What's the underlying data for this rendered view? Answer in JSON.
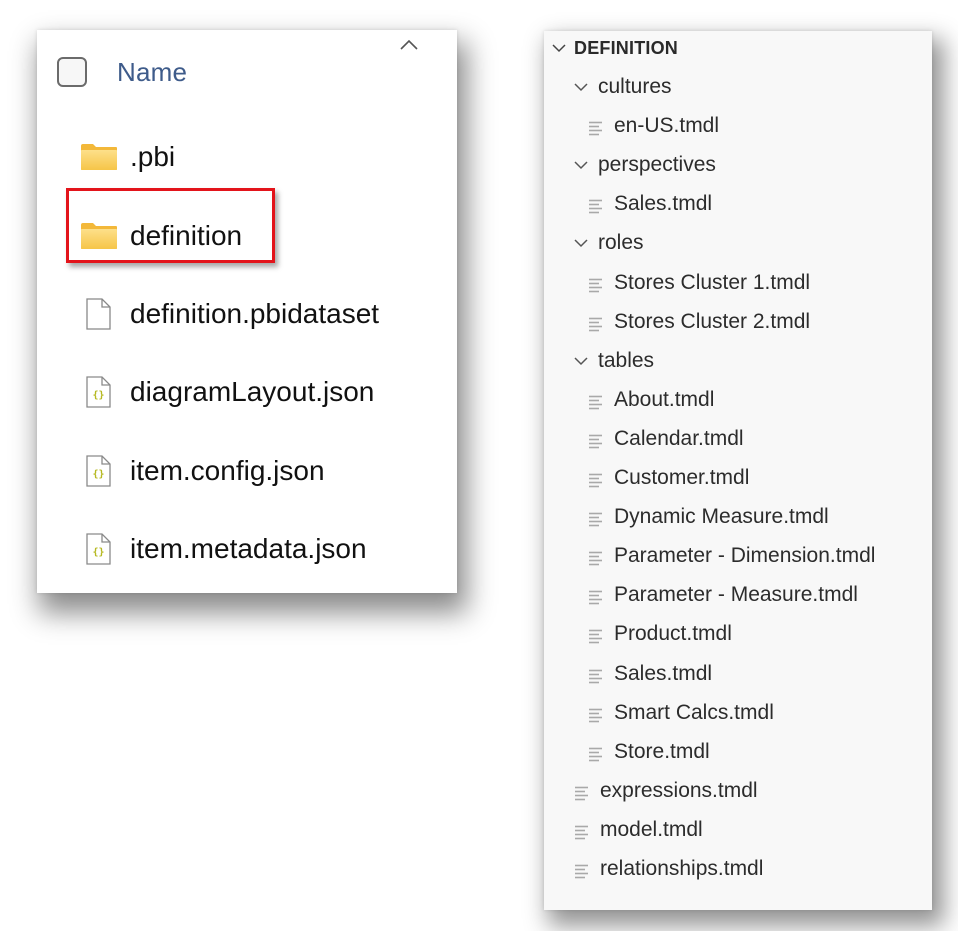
{
  "file_explorer": {
    "header": {
      "sort_indicator_icon": "chevron-up-icon",
      "select_all_checked": false,
      "name_column_label": "Name"
    },
    "items": [
      {
        "name": ".pbi",
        "type": "folder",
        "icon": "folder-icon",
        "highlighted": false
      },
      {
        "name": "definition",
        "type": "folder",
        "icon": "folder-icon",
        "highlighted": true
      },
      {
        "name": "definition.pbidataset",
        "type": "file",
        "icon": "file-icon",
        "highlighted": false
      },
      {
        "name": "diagramLayout.json",
        "type": "json",
        "icon": "json-file-icon",
        "highlighted": false
      },
      {
        "name": "item.config.json",
        "type": "json",
        "icon": "json-file-icon",
        "highlighted": false
      },
      {
        "name": "item.metadata.json",
        "type": "json",
        "icon": "json-file-icon",
        "highlighted": false
      }
    ],
    "highlight_color": "#e3141b",
    "folder_color": "#f5c94a",
    "json_brace_color": "#b5b81f"
  },
  "tree": {
    "root": {
      "label": "DEFINITION",
      "expanded": true
    },
    "nodes": [
      {
        "label": "cultures",
        "kind": "folder",
        "level": 1,
        "expanded": true
      },
      {
        "label": "en-US.tmdl",
        "kind": "file",
        "level": 2
      },
      {
        "label": "perspectives",
        "kind": "folder",
        "level": 1,
        "expanded": true
      },
      {
        "label": "Sales.tmdl",
        "kind": "file",
        "level": 2
      },
      {
        "label": "roles",
        "kind": "folder",
        "level": 1,
        "expanded": true
      },
      {
        "label": "Stores Cluster 1.tmdl",
        "kind": "file",
        "level": 2
      },
      {
        "label": "Stores Cluster 2.tmdl",
        "kind": "file",
        "level": 2
      },
      {
        "label": "tables",
        "kind": "folder",
        "level": 1,
        "expanded": true
      },
      {
        "label": "About.tmdl",
        "kind": "file",
        "level": 2
      },
      {
        "label": "Calendar.tmdl",
        "kind": "file",
        "level": 2
      },
      {
        "label": "Customer.tmdl",
        "kind": "file",
        "level": 2
      },
      {
        "label": "Dynamic Measure.tmdl",
        "kind": "file",
        "level": 2
      },
      {
        "label": "Parameter - Dimension.tmdl",
        "kind": "file",
        "level": 2
      },
      {
        "label": "Parameter - Measure.tmdl",
        "kind": "file",
        "level": 2
      },
      {
        "label": "Product.tmdl",
        "kind": "file",
        "level": 2
      },
      {
        "label": "Sales.tmdl",
        "kind": "file",
        "level": 2
      },
      {
        "label": "Smart Calcs.tmdl",
        "kind": "file",
        "level": 2
      },
      {
        "label": "Store.tmdl",
        "kind": "file",
        "level": 2
      },
      {
        "label": "expressions.tmdl",
        "kind": "file",
        "level": 1
      },
      {
        "label": "model.tmdl",
        "kind": "file",
        "level": 1
      },
      {
        "label": "relationships.tmdl",
        "kind": "file",
        "level": 1
      }
    ]
  }
}
